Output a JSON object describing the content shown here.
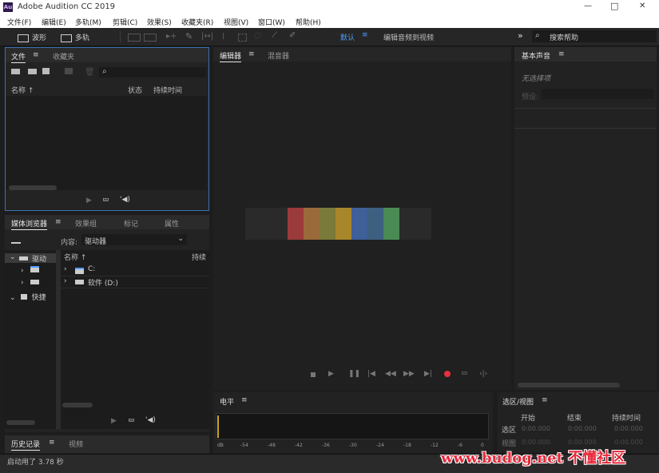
{
  "app": {
    "title": "Adobe Audition CC 2019",
    "logo_text": "Au",
    "win_min": "—",
    "win_max": "□",
    "win_close": "✕"
  },
  "menu": {
    "items": [
      "文件(F)",
      "编辑(E)",
      "多轨(M)",
      "剪辑(C)",
      "效果(S)",
      "收藏夹(R)",
      "视图(V)",
      "窗口(W)",
      "帮助(H)"
    ]
  },
  "toolbar": {
    "waveform_label": "波形",
    "multitrack_label": "多轨",
    "workspace_default": "默认",
    "workspace_menu_glyph": "≡",
    "workspace_other": "编辑音频到视频",
    "more_glyph": "»",
    "search_placeholder": "搜索帮助"
  },
  "files_panel": {
    "tab_files": "文件",
    "tab_menu": "≡",
    "tab_favorites": "收藏夹",
    "search_glyph": "⌕",
    "col_name": "名称 ↑",
    "col_status": "状态",
    "col_duration": "持续时间"
  },
  "media_browser": {
    "tab_media": "媒体浏览器",
    "tab_menu": "≡",
    "tab_effects_group": "效果组",
    "tab_markers": "标记",
    "tab_properties": "属性",
    "content_label": "内容:",
    "content_value": "驱动器",
    "tree_drives": "驱动",
    "tree_shortcuts": "快捷",
    "col_name": "名称 ↑",
    "col_duration": "持续",
    "items": [
      {
        "name": "C:"
      },
      {
        "name": "软件 (D:)"
      }
    ]
  },
  "history_panel": {
    "tab_history": "历史记录",
    "tab_menu": "≡",
    "tab_video": "视频"
  },
  "editor": {
    "tab_editor": "编辑器",
    "tab_menu": "≡",
    "tab_mixer": "混音器",
    "colors": [
      "#9b3a3a",
      "#9a6a3a",
      "#7a7a3a",
      "#a8862a",
      "#3f5f99",
      "#3d5f80",
      "#4a8a55"
    ]
  },
  "levels_panel": {
    "tab_levels": "电平",
    "tab_menu": "≡",
    "scale": [
      "dB",
      "-54",
      "-48",
      "-42",
      "-36",
      "-30",
      "-24",
      "-18",
      "-12",
      "-6",
      "0"
    ]
  },
  "essential_sound": {
    "tab_label": "基本声音",
    "tab_menu": "≡",
    "no_selection": "无选择项",
    "preset_label": "预设:"
  },
  "selection_view": {
    "tab_label": "选区/视图",
    "tab_menu": "≡",
    "col_start": "开始",
    "col_end": "结束",
    "col_duration": "持续时间",
    "row_selection": "选区",
    "row_view": "视图",
    "sel_start": "0:00.000",
    "sel_end": "0:00.000",
    "sel_duration": "0:00.000",
    "view_start": "0:00.000",
    "view_end": "0:00.000",
    "view_duration": "0:00.000"
  },
  "status": {
    "text": "启动用了 3.78 秒"
  },
  "watermark": {
    "text": "www.budog.net 不懂社区"
  }
}
